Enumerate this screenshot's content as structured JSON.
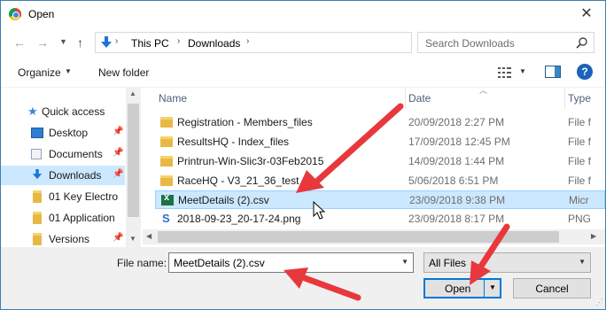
{
  "window": {
    "title": "Open"
  },
  "address": {
    "crumbs": [
      "This PC",
      "Downloads"
    ],
    "search_placeholder": "Search Downloads"
  },
  "toolbar": {
    "organize": "Organize",
    "new_folder": "New folder"
  },
  "sidebar": {
    "items": [
      {
        "label": "Quick access",
        "icon": "star-icon"
      },
      {
        "label": "Desktop",
        "icon": "desktop-icon"
      },
      {
        "label": "Documents",
        "icon": "documents-icon"
      },
      {
        "label": "Downloads",
        "icon": "download-arrow-icon",
        "selected": true
      },
      {
        "label": "01 Key Electro",
        "icon": "folder-icon"
      },
      {
        "label": "01 Application",
        "icon": "folder-icon"
      },
      {
        "label": "Versions",
        "icon": "folder-icon"
      }
    ]
  },
  "columns": {
    "name": "Name",
    "date": "Date",
    "type": "Type"
  },
  "files": [
    {
      "name": "Registration - Members_files",
      "date": "20/09/2018 2:27 PM",
      "type": "File f",
      "icon": "folder-icon"
    },
    {
      "name": "ResultsHQ - Index_files",
      "date": "17/09/2018 12:45 PM",
      "type": "File f",
      "icon": "folder-icon"
    },
    {
      "name": "Printrun-Win-Slic3r-03Feb2015",
      "date": "14/09/2018 1:44 PM",
      "type": "File f",
      "icon": "folder-icon"
    },
    {
      "name": "RaceHQ - V3_21_36_test",
      "date": "5/06/2018 6:51 PM",
      "type": "File f",
      "icon": "folder-icon"
    },
    {
      "name": "MeetDetails (2).csv",
      "date": "23/09/2018 9:38 PM",
      "type": "Micr",
      "icon": "csv-file-icon",
      "selected": true
    },
    {
      "name": "2018-09-23_20-17-24.png",
      "date": "23/09/2018 8:17 PM",
      "type": "PNG",
      "icon": "png-file-icon"
    }
  ],
  "bottom": {
    "file_name_label": "File name:",
    "file_name_value": "MeetDetails (2).csv",
    "filter": "All Files",
    "open": "Open",
    "cancel": "Cancel"
  },
  "colors": {
    "accent": "#0078d7",
    "selection": "#cce8ff",
    "arrow": "#e8383d"
  }
}
